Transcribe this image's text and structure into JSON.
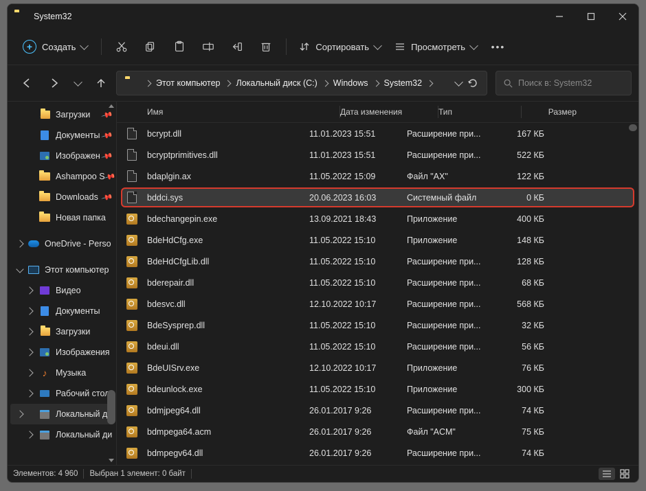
{
  "window": {
    "title": "System32"
  },
  "toolbar": {
    "new_label": "Создать",
    "sort_label": "Сортировать",
    "view_label": "Просмотреть"
  },
  "breadcrumb": {
    "segments": [
      "Этот компьютер",
      "Локальный диск (C:)",
      "Windows",
      "System32"
    ]
  },
  "search": {
    "placeholder": "Поиск в: System32"
  },
  "columns": {
    "name": "Имя",
    "date": "Дата изменения",
    "type": "Тип",
    "size": "Размер"
  },
  "sidebar": {
    "items": [
      {
        "label": "Загрузки",
        "icon": "downloads",
        "pinned": true
      },
      {
        "label": "Документы",
        "icon": "doc",
        "pinned": true
      },
      {
        "label": "Изображен",
        "icon": "img",
        "pinned": true
      },
      {
        "label": "Ashampoo S",
        "icon": "folder",
        "pinned": true
      },
      {
        "label": "Downloads",
        "icon": "folder",
        "pinned": true
      },
      {
        "label": "Новая папка",
        "icon": "folder",
        "pinned": false
      }
    ],
    "onedrive": "OneDrive - Perso",
    "thispc": "Этот компьютер",
    "pc_children": [
      {
        "label": "Видео",
        "icon": "vid"
      },
      {
        "label": "Документы",
        "icon": "doc"
      },
      {
        "label": "Загрузки",
        "icon": "downloads"
      },
      {
        "label": "Изображения",
        "icon": "img"
      },
      {
        "label": "Музыка",
        "icon": "mus"
      },
      {
        "label": "Рабочий стол",
        "icon": "desk"
      },
      {
        "label": "Локальный ди",
        "icon": "disk",
        "active": true
      },
      {
        "label": "Локальный ди",
        "icon": "disk"
      }
    ]
  },
  "files": [
    {
      "name": "bcrypt.dll",
      "date": "11.01.2023 15:51",
      "type": "Расширение при...",
      "size": "167 КБ",
      "icon": "page"
    },
    {
      "name": "bcryptprimitives.dll",
      "date": "11.01.2023 15:51",
      "type": "Расширение при...",
      "size": "522 КБ",
      "icon": "page"
    },
    {
      "name": "bdaplgin.ax",
      "date": "11.05.2022 15:09",
      "type": "Файл \"AX\"",
      "size": "122 КБ",
      "icon": "page"
    },
    {
      "name": "bddci.sys",
      "date": "20.06.2023 16:03",
      "type": "Системный файл",
      "size": "0 КБ",
      "icon": "page",
      "selected": true
    },
    {
      "name": "bdechangepin.exe",
      "date": "13.09.2021 18:43",
      "type": "Приложение",
      "size": "400 КБ",
      "icon": "app"
    },
    {
      "name": "BdeHdCfg.exe",
      "date": "11.05.2022 15:10",
      "type": "Приложение",
      "size": "148 КБ",
      "icon": "app"
    },
    {
      "name": "BdeHdCfgLib.dll",
      "date": "11.05.2022 15:10",
      "type": "Расширение при...",
      "size": "128 КБ",
      "icon": "app"
    },
    {
      "name": "bderepair.dll",
      "date": "11.05.2022 15:10",
      "type": "Расширение при...",
      "size": "68 КБ",
      "icon": "app"
    },
    {
      "name": "bdesvc.dll",
      "date": "12.10.2022 10:17",
      "type": "Расширение при...",
      "size": "568 КБ",
      "icon": "app"
    },
    {
      "name": "BdeSysprep.dll",
      "date": "11.05.2022 15:10",
      "type": "Расширение при...",
      "size": "32 КБ",
      "icon": "app"
    },
    {
      "name": "bdeui.dll",
      "date": "11.05.2022 15:10",
      "type": "Расширение при...",
      "size": "56 КБ",
      "icon": "app"
    },
    {
      "name": "BdeUISrv.exe",
      "date": "12.10.2022 10:17",
      "type": "Приложение",
      "size": "76 КБ",
      "icon": "app"
    },
    {
      "name": "bdeunlock.exe",
      "date": "11.05.2022 15:10",
      "type": "Приложение",
      "size": "300 КБ",
      "icon": "app"
    },
    {
      "name": "bdmjpeg64.dll",
      "date": "26.01.2017 9:26",
      "type": "Расширение при...",
      "size": "74 КБ",
      "icon": "app"
    },
    {
      "name": "bdmpega64.acm",
      "date": "26.01.2017 9:26",
      "type": "Файл \"ACM\"",
      "size": "75 КБ",
      "icon": "app"
    },
    {
      "name": "bdmpegv64.dll",
      "date": "26.01.2017 9:26",
      "type": "Расширение при...",
      "size": "74 КБ",
      "icon": "app"
    }
  ],
  "status": {
    "count_label": "Элементов: 4 960",
    "selection_label": "Выбран 1 элемент: 0 байт"
  }
}
